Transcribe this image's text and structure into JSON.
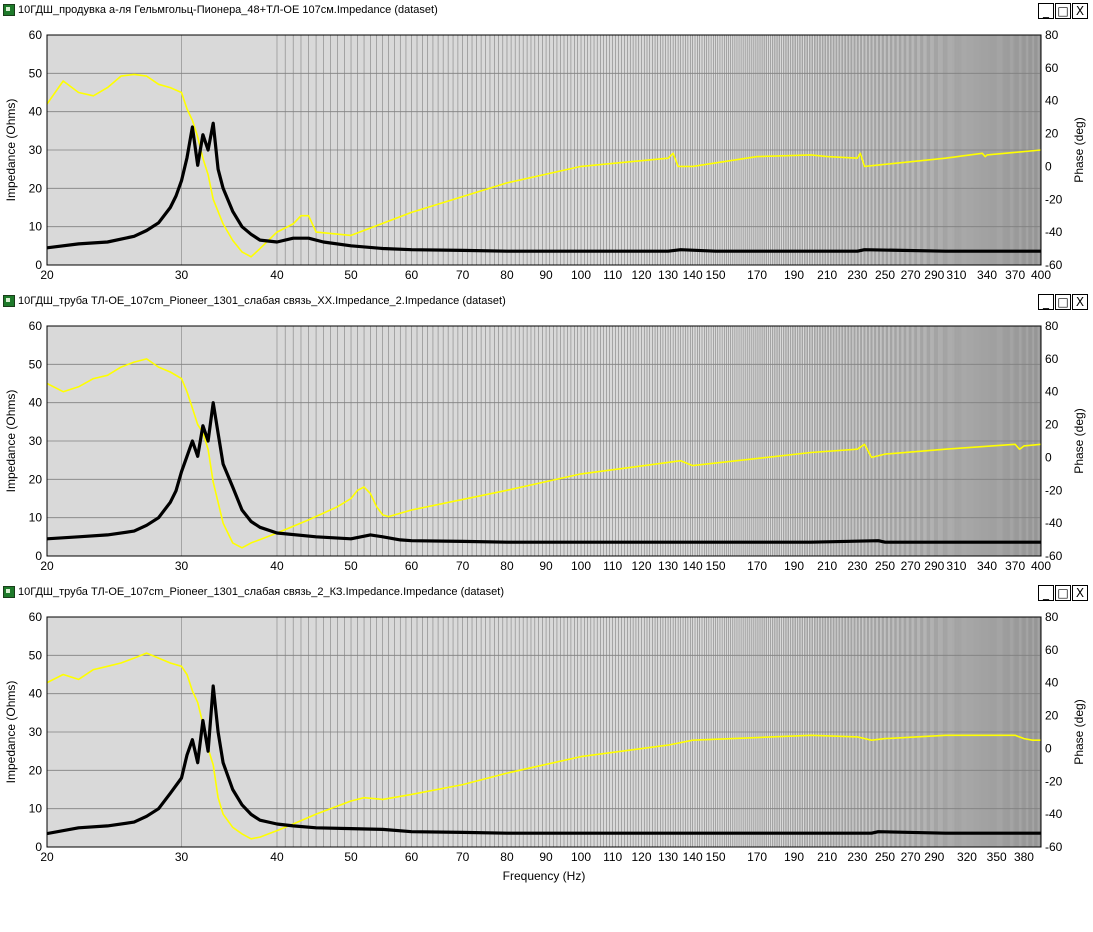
{
  "windows": [
    {
      "title": "10ГДШ_продувка а-ля Гельмгольц-Пионера_48+ТЛ-ОЕ 107см.Impedance (dataset)",
      "controls": {
        "minimize": "_",
        "maximize": "□",
        "close": "X"
      }
    },
    {
      "title": "10ГДШ_труба ТЛ-ОЕ_107cm_Pioneer_1301_слабая связь_ХХ.Impedance_2.Impedance (dataset)",
      "controls": {
        "minimize": "_",
        "maximize": "□",
        "close": "X"
      }
    },
    {
      "title": "10ГДШ_труба ТЛ-ОЕ_107cm_Pioneer_1301_слабая связь_2_КЗ.Impedance.Impedance (dataset)",
      "controls": {
        "minimize": "_",
        "maximize": "□",
        "close": "X"
      }
    }
  ],
  "chart_data": [
    {
      "type": "line",
      "title": "10ГДШ_продувка а-ля Гельмгольц-Пионера_48+ТЛ-ОЕ 107см.Impedance (dataset)",
      "xlabel": "",
      "ylabel": "Impedance (Ohms)",
      "y2label": "Phase (deg)",
      "x_scale": "log",
      "xlim": [
        20,
        400
      ],
      "ylim": [
        0,
        60
      ],
      "y2lim": [
        -60,
        80
      ],
      "x_ticks": [
        20,
        30,
        40,
        50,
        60,
        70,
        80,
        90,
        100,
        110,
        120,
        130,
        140,
        150,
        170,
        190,
        210,
        230,
        250,
        270,
        290,
        310,
        340,
        370,
        400
      ],
      "y_ticks": [
        0,
        10,
        20,
        30,
        40,
        50,
        60
      ],
      "y2_ticks": [
        -60,
        -40,
        -20,
        0,
        20,
        40,
        60,
        80
      ],
      "grid": true,
      "colors": {
        "impedance": "#000000",
        "phase": "#ffff00",
        "background": "#d9d9d9"
      },
      "series": [
        {
          "axis": "left",
          "x": [
            20,
            22,
            24,
            26,
            27,
            28,
            29,
            29.5,
            30,
            30.5,
            31,
            31.5,
            32,
            32.5,
            33,
            33.5,
            34,
            35,
            36,
            37,
            38,
            40,
            42,
            44,
            46,
            50,
            55,
            60,
            70,
            80,
            100,
            130,
            135,
            150,
            200,
            230,
            235,
            300,
            400
          ],
          "values": [
            4.5,
            5.5,
            6,
            7.5,
            9,
            11,
            15,
            18,
            22,
            28,
            36,
            26,
            34,
            30,
            37,
            25,
            20,
            14,
            10,
            8,
            6.5,
            6,
            7,
            7,
            6,
            5,
            4.3,
            4,
            3.8,
            3.6,
            3.6,
            3.6,
            4.0,
            3.6,
            3.6,
            3.6,
            4.0,
            3.6,
            3.6
          ]
        },
        {
          "axis": "right",
          "x": [
            20,
            21,
            22,
            23,
            24,
            25,
            26,
            27,
            28,
            29,
            30,
            30.5,
            31,
            31.5,
            32,
            32.5,
            33,
            34,
            35,
            36,
            37,
            38,
            40,
            42,
            43,
            44,
            45,
            50,
            60,
            80,
            100,
            130,
            132,
            134,
            140,
            170,
            200,
            210,
            230,
            232,
            235,
            300,
            335,
            338,
            340,
            400
          ],
          "values": [
            38,
            52,
            45,
            43,
            48,
            55,
            56,
            55,
            50,
            48,
            45,
            35,
            28,
            18,
            5,
            -5,
            -20,
            -35,
            -45,
            -52,
            -55,
            -50,
            -40,
            -35,
            -30,
            -30,
            -40,
            -42,
            -28,
            -10,
            0,
            5,
            8,
            0,
            0,
            6,
            7,
            6,
            5,
            8,
            0,
            5,
            8,
            6,
            7,
            10
          ]
        }
      ]
    },
    {
      "type": "line",
      "title": "10ГДШ_труба ТЛ-ОЕ_107cm_Pioneer_1301_слабая связь_ХХ.Impedance_2.Impedance (dataset)",
      "xlabel": "",
      "ylabel": "Impedance (Ohms)",
      "y2label": "Phase (deg)",
      "x_scale": "log",
      "xlim": [
        20,
        400
      ],
      "ylim": [
        0,
        60
      ],
      "y2lim": [
        -60,
        80
      ],
      "x_ticks": [
        20,
        30,
        40,
        50,
        60,
        70,
        80,
        90,
        100,
        110,
        120,
        130,
        140,
        150,
        170,
        190,
        210,
        230,
        250,
        270,
        290,
        310,
        340,
        370,
        400
      ],
      "y_ticks": [
        0,
        10,
        20,
        30,
        40,
        50,
        60
      ],
      "y2_ticks": [
        -60,
        -40,
        -20,
        0,
        20,
        40,
        60,
        80
      ],
      "grid": true,
      "colors": {
        "impedance": "#000000",
        "phase": "#ffff00",
        "background": "#d9d9d9"
      },
      "series": [
        {
          "axis": "left",
          "x": [
            20,
            22,
            24,
            26,
            27,
            28,
            29,
            29.5,
            30,
            30.5,
            31,
            31.5,
            32,
            32.5,
            33,
            33.5,
            34,
            35,
            36,
            37,
            38,
            40,
            45,
            50,
            53,
            55,
            58,
            60,
            70,
            80,
            100,
            200,
            245,
            250,
            300,
            400
          ],
          "values": [
            4.5,
            5,
            5.5,
            6.5,
            8,
            10,
            14,
            17,
            22,
            26,
            30,
            26,
            34,
            30,
            40,
            32,
            24,
            18,
            12,
            9,
            7.5,
            6,
            5,
            4.5,
            5.5,
            5,
            4.2,
            4,
            3.8,
            3.6,
            3.6,
            3.6,
            4,
            3.6,
            3.6,
            3.6
          ]
        },
        {
          "axis": "right",
          "x": [
            20,
            21,
            22,
            23,
            24,
            25,
            26,
            27,
            28,
            29,
            30,
            30.5,
            31,
            31.5,
            32,
            32.5,
            33,
            34,
            35,
            36,
            37,
            38,
            40,
            44,
            48,
            50,
            51,
            52,
            53,
            54,
            55,
            56,
            60,
            80,
            100,
            130,
            135,
            140,
            200,
            230,
            235,
            240,
            250,
            300,
            370,
            375,
            380,
            400
          ],
          "values": [
            45,
            40,
            43,
            48,
            50,
            55,
            58,
            60,
            55,
            52,
            48,
            40,
            30,
            20,
            15,
            5,
            -15,
            -40,
            -52,
            -55,
            -52,
            -50,
            -46,
            -38,
            -30,
            -25,
            -20,
            -18,
            -22,
            -30,
            -35,
            -36,
            -32,
            -20,
            -10,
            -3,
            -2,
            -5,
            3,
            5,
            8,
            0,
            2,
            5,
            8,
            5,
            7,
            8
          ]
        }
      ]
    },
    {
      "type": "line",
      "title": "10ГДШ_труба ТЛ-ОЕ_107cm_Pioneer_1301_слабая связь_2_КЗ.Impedance.Impedance (dataset)",
      "xlabel": "Frequency (Hz)",
      "ylabel": "Impedance (Ohms)",
      "y2label": "Phase (deg)",
      "x_scale": "log",
      "xlim": [
        20,
        400
      ],
      "ylim": [
        0,
        60
      ],
      "y2lim": [
        -60,
        80
      ],
      "x_ticks": [
        20,
        30,
        40,
        50,
        60,
        70,
        80,
        90,
        100,
        110,
        120,
        130,
        140,
        150,
        170,
        190,
        210,
        230,
        250,
        270,
        290,
        320,
        350,
        380
      ],
      "y_ticks": [
        0,
        10,
        20,
        30,
        40,
        50,
        60
      ],
      "y2_ticks": [
        -60,
        -40,
        -20,
        0,
        20,
        40,
        60,
        80
      ],
      "grid": true,
      "colors": {
        "impedance": "#000000",
        "phase": "#ffff00",
        "background": "#d9d9d9"
      },
      "series": [
        {
          "axis": "left",
          "x": [
            20,
            22,
            24,
            26,
            27,
            28,
            29,
            30,
            30.5,
            31,
            31.5,
            32,
            32.5,
            33,
            33.5,
            34,
            35,
            36,
            37,
            38,
            40,
            42,
            45,
            50,
            55,
            60,
            70,
            80,
            100,
            200,
            240,
            245,
            300,
            400
          ],
          "values": [
            3.5,
            5,
            5.5,
            6.5,
            8,
            10,
            14,
            18,
            24,
            28,
            22,
            33,
            25,
            42,
            30,
            22,
            15,
            11,
            8.5,
            7,
            6,
            5.5,
            5,
            4.8,
            4.6,
            4,
            3.8,
            3.6,
            3.6,
            3.6,
            3.6,
            4,
            3.6,
            3.6
          ]
        },
        {
          "axis": "right",
          "x": [
            20,
            21,
            22,
            23,
            24,
            25,
            26,
            27,
            28,
            29,
            30,
            30.5,
            31,
            31.5,
            32,
            32.5,
            33,
            33.5,
            34,
            35,
            36,
            37,
            38,
            40,
            42,
            45,
            50,
            52,
            55,
            60,
            70,
            80,
            100,
            130,
            140,
            200,
            230,
            240,
            250,
            300,
            370,
            380,
            390,
            400
          ],
          "values": [
            40,
            45,
            42,
            48,
            50,
            52,
            55,
            58,
            55,
            52,
            50,
            45,
            35,
            28,
            15,
            0,
            -10,
            -30,
            -40,
            -48,
            -52,
            -55,
            -54,
            -50,
            -46,
            -40,
            -32,
            -30,
            -31,
            -28,
            -22,
            -15,
            -5,
            2,
            5,
            8,
            7,
            5,
            6,
            8,
            8,
            6,
            5,
            5
          ]
        }
      ]
    }
  ]
}
